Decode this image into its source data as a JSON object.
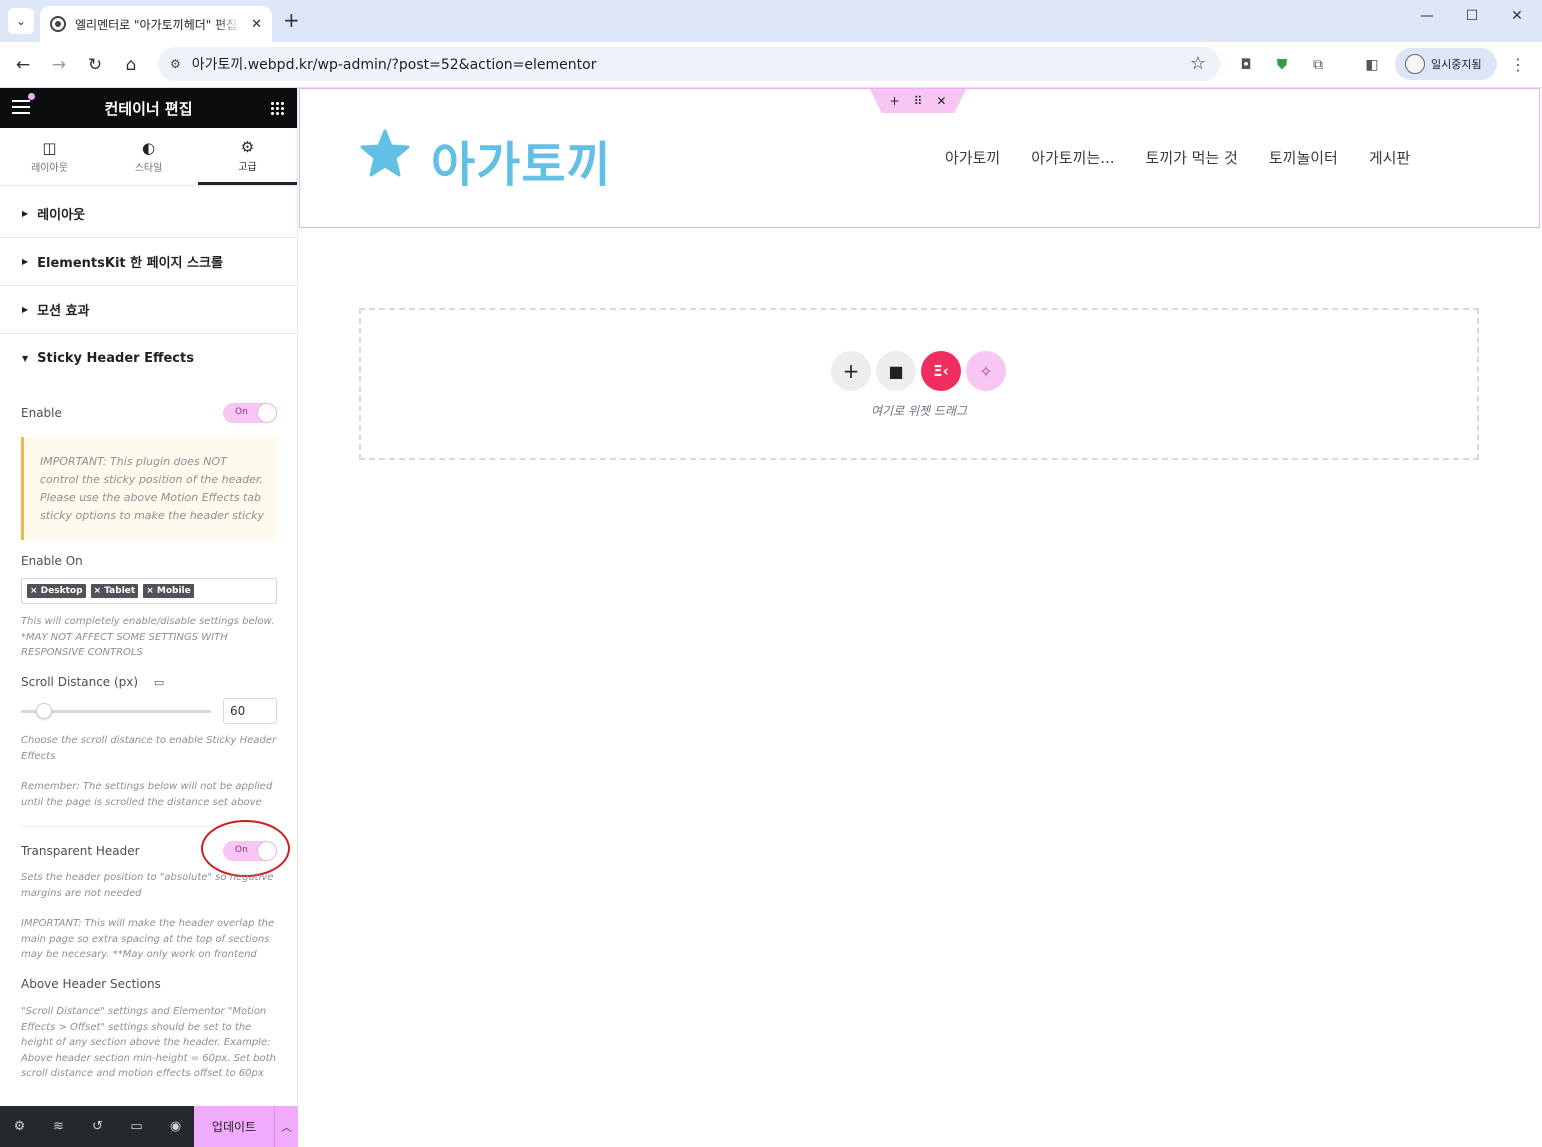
{
  "browser": {
    "tab_title": "엘리멘터로 \"아가토끼헤더\" 편집",
    "url": "아가토끼.webpd.kr/wp-admin/?post=52&action=elementor",
    "profile_label": "일시중지됨"
  },
  "panel": {
    "title": "컨테이너 편집",
    "tabs": [
      {
        "label": "레이아웃",
        "icon": "layout-icon"
      },
      {
        "label": "스타일",
        "icon": "style-icon"
      },
      {
        "label": "고급",
        "icon": "gear-icon"
      }
    ],
    "sections": [
      {
        "label": "레이아웃"
      },
      {
        "label": "ElementsKit 한 페이지 스크롤"
      },
      {
        "label": "모션 효과"
      },
      {
        "label": "Sticky Header Effects"
      }
    ],
    "enable_label": "Enable",
    "toggle_on": "On",
    "notice": "IMPORTANT: This plugin does NOT control the sticky position of the header. Please use the above Motion Effects tab sticky options to make the header sticky",
    "enable_on_label": "Enable On",
    "enable_on_tags": [
      "× Desktop",
      "× Tablet",
      "× Mobile"
    ],
    "enable_on_help": "This will completely enable/disable settings below. *MAY NOT AFFECT SOME SETTINGS WITH RESPONSIVE CONTROLS",
    "scroll_distance_label": "Scroll Distance (px)",
    "scroll_distance_value": "60",
    "scroll_distance_fraction": 0.1,
    "scroll_help": "Choose the scroll distance to enable Sticky Header Effects",
    "remember_help": "Remember: The settings below will not be applied until the page is scrolled the distance set above",
    "transparent_label": "Transparent Header",
    "transparent_help": "Sets the header position to \"absolute\" so negative margins are not needed",
    "transparent_important": "IMPORTANT: This will make the header overlap the main page so extra spacing at the top of sections may be necesary. **May only work on frontend",
    "above_label": "Above Header Sections",
    "above_help": "\"Scroll Distance\" settings and Elementor \"Motion Effects > Offset\" settings should be set to the height of any section above the header. Example: Above header section min-height = 60px. Set both scroll distance and motion effects offset to 60px",
    "update_label": "업데이트"
  },
  "preview": {
    "logo_text": "아가토끼",
    "menu": [
      "아가토끼",
      "아가토끼는...",
      "토끼가 먹는 것",
      "토끼놀이터",
      "게시판"
    ],
    "drop_text": "여기로 위젯 드래그"
  },
  "colors": {
    "accent_pink": "#f0abfc",
    "logo_blue": "#62bfe6",
    "elementskit_red": "#ef2d5e",
    "panel_header": "#0c0d0e"
  }
}
